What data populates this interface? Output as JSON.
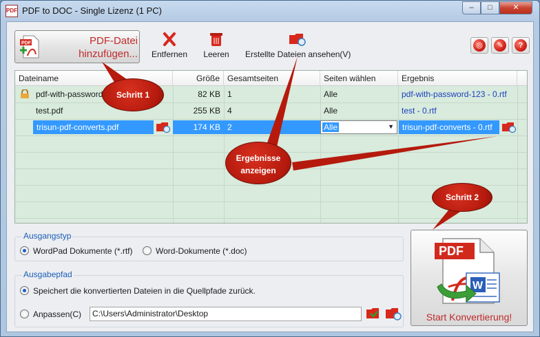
{
  "window": {
    "title": "PDF to DOC - Single Lizenz (1 PC)",
    "app_icon": "PDF",
    "controls": {
      "minimize": "–",
      "maximize": "□",
      "close": "✕"
    }
  },
  "toolbar": {
    "add_label_line1": "PDF-Datei",
    "add_label_line2": "hinzufügen...",
    "remove_label": "Entfernen",
    "clear_label": "Leeren",
    "view_label": "Erstellte Dateien ansehen(V)",
    "icons": [
      "pdf-add-icon",
      "red-x-icon",
      "trash-icon",
      "folder-search-icon"
    ],
    "right_buttons": [
      {
        "name": "web-icon",
        "glyph": "◎"
      },
      {
        "name": "settings-icon",
        "glyph": "✎"
      },
      {
        "name": "help-icon",
        "glyph": "?"
      }
    ]
  },
  "grid": {
    "columns": [
      "Dateiname",
      "Größe",
      "Gesamtseiten",
      "Seiten wählen",
      "Ergebnis"
    ],
    "rows": [
      {
        "name": "pdf-with-password.pdf",
        "size": "82 KB",
        "pages": "1",
        "select": "Alle",
        "result": "pdf-with-password-123 - 0.rtf",
        "locked": true,
        "selected": false
      },
      {
        "name": "test.pdf",
        "size": "255 KB",
        "pages": "4",
        "select": "Alle",
        "result": "test - 0.rtf",
        "locked": false,
        "selected": false
      },
      {
        "name": "trisun-pdf-converts.pdf",
        "size": "174 KB",
        "pages": "2",
        "select": "Alle",
        "result": "trisun-pdf-converts - 0.rtf",
        "locked": false,
        "selected": true
      }
    ]
  },
  "output_type": {
    "title": "Ausgangstyp",
    "options": [
      "WordPad Dokumente (*.rtf)",
      "Word-Dokumente (*.doc)"
    ],
    "selected": 0
  },
  "output_path": {
    "title": "Ausgabepfad",
    "option_source": "Speichert die konvertierten Dateien in die Quellpfade zurück.",
    "option_custom": "Anpassen(C)",
    "path_value": "C:\\Users\\Administrator\\Desktop",
    "selected": 0
  },
  "start": {
    "label": "Start Konvertierung!",
    "icon_text": "PDF",
    "word_letter": "W"
  },
  "callouts": {
    "step1": "Schritt 1",
    "results_line1": "Ergebnisse",
    "results_line2": "anzeigen",
    "step2": "Schritt 2"
  },
  "colors": {
    "accent_red": "#c02a2a",
    "grid_bg": "#d8ebdc",
    "selection": "#3399ff",
    "link": "#1b3fbf",
    "group_title": "#1c5db8"
  }
}
